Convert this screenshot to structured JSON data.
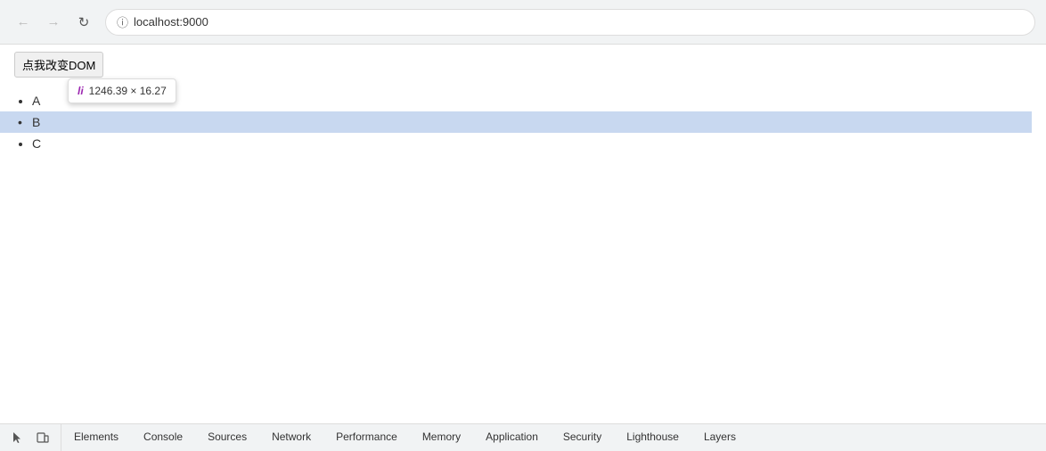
{
  "browser": {
    "url": "localhost:9000",
    "back_disabled": true,
    "forward_disabled": true
  },
  "page": {
    "button_label": "点我改变DOM",
    "list_items": [
      {
        "text": "A",
        "highlighted": false
      },
      {
        "text": "B",
        "highlighted": true
      },
      {
        "text": "C",
        "highlighted": false
      }
    ],
    "tooltip": {
      "tag": "li",
      "size": "1246.39 × 16.27"
    }
  },
  "devtools": {
    "tabs": [
      {
        "id": "elements",
        "label": "Elements",
        "active": false
      },
      {
        "id": "console",
        "label": "Console",
        "active": false
      },
      {
        "id": "sources",
        "label": "Sources",
        "active": false
      },
      {
        "id": "network",
        "label": "Network",
        "active": false
      },
      {
        "id": "performance",
        "label": "Performance",
        "active": false
      },
      {
        "id": "memory",
        "label": "Memory",
        "active": false
      },
      {
        "id": "application",
        "label": "Application",
        "active": false
      },
      {
        "id": "security",
        "label": "Security",
        "active": false
      },
      {
        "id": "lighthouse",
        "label": "Lighthouse",
        "active": false
      },
      {
        "id": "layers",
        "label": "Layers",
        "active": false
      }
    ]
  }
}
